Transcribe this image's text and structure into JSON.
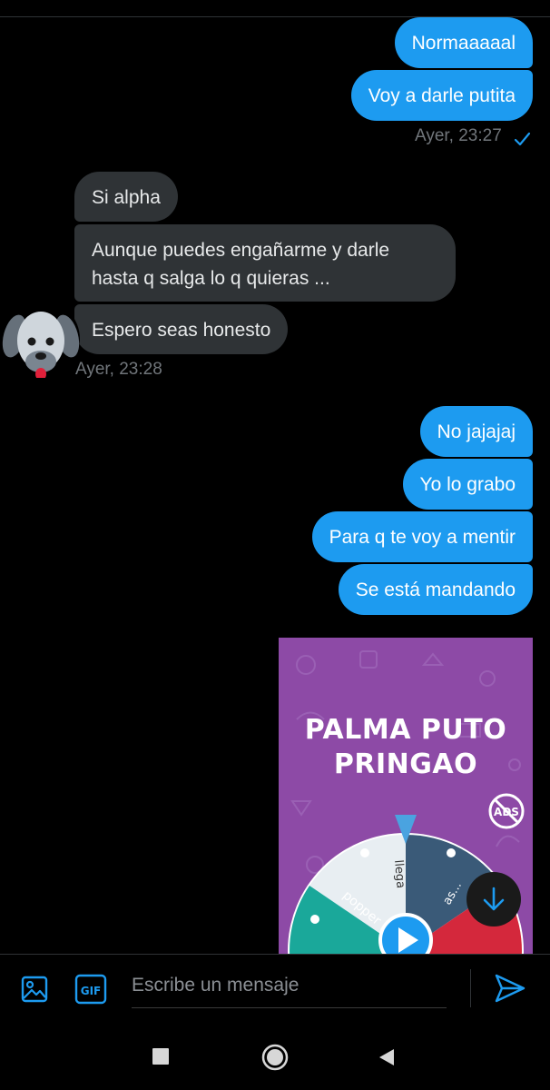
{
  "conversation": {
    "outgoing_group_1": [
      "Normaaaaal",
      "Voy a darle putita"
    ],
    "outgoing_group_1_time": "Ayer, 23:27",
    "incoming_group": [
      "Si alpha",
      "Aunque puedes engañarme y darle",
      "hasta q salga lo q quieras ...",
      "Espero seas honesto"
    ],
    "incoming_group_time": "Ayer, 23:28",
    "outgoing_group_2": [
      "No jajajaj",
      "Yo lo grabo",
      "Para q te voy a mentir",
      "Se está mandando"
    ]
  },
  "media": {
    "title_line1": "PALMA PUTO",
    "title_line2": "PRINGAO",
    "no_ads_badge": "ADS",
    "wheel_labels": [
      "popper 2€",
      "llega",
      "as..."
    ],
    "background_color": "#8d4aa6"
  },
  "composer": {
    "placeholder": "Escribe un mensaje",
    "image_icon": "image-icon",
    "gif_label": "GIF",
    "send_icon": "send-icon"
  },
  "navbar": {
    "icons": [
      "recents-square-icon",
      "home-circle-icon",
      "back-triangle-icon"
    ]
  },
  "colors": {
    "accent": "#1d9bf0",
    "incoming_bubble": "#2f3336",
    "background": "#000000"
  }
}
